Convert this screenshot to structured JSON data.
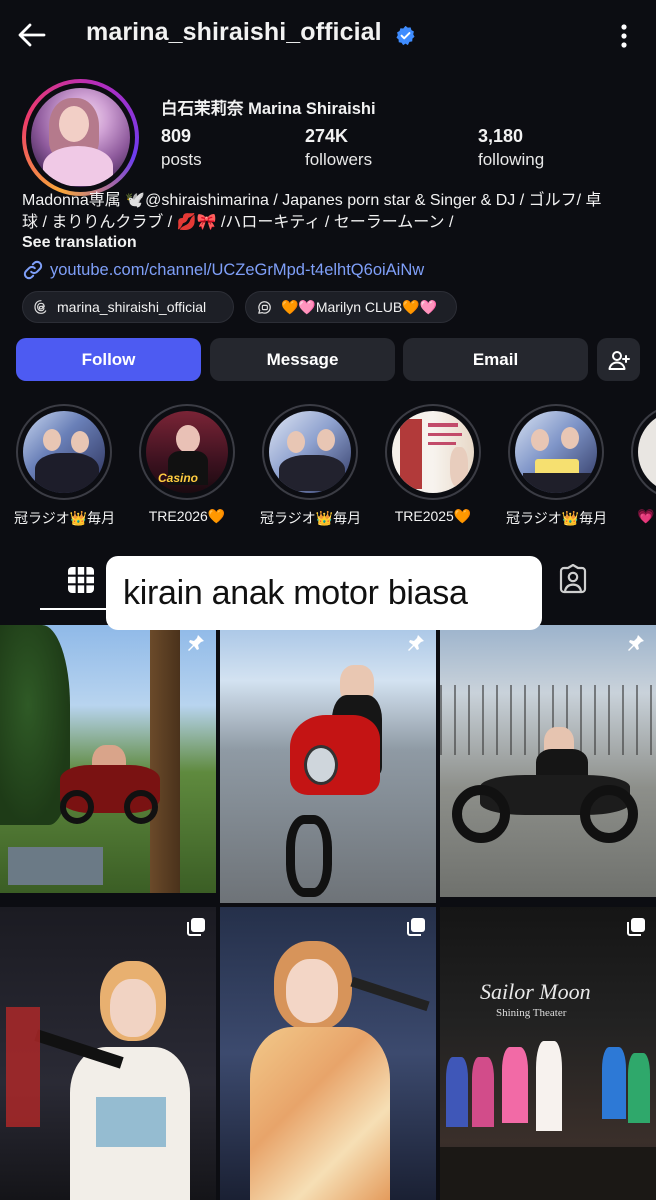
{
  "header": {
    "username": "marina_shiraishi_official",
    "verified": true,
    "icons": {
      "back": "arrow-left-icon",
      "menu": "more-vertical-icon",
      "badge": "verified-badge-icon"
    }
  },
  "profile": {
    "full_name": "白石茉莉奈 Marina Shiraishi",
    "stats": {
      "posts": {
        "value": "809",
        "label": "posts"
      },
      "followers": {
        "value": "274K",
        "label": "followers"
      },
      "following": {
        "value": "3,180",
        "label": "following"
      }
    },
    "bio_line1": "Madonna専属 🕊️@shiraishimarina / Japanes porn star & Singer & DJ / ゴルフ/ 卓",
    "bio_line2": "球 / まりりんクラブ / 💋🎀 /ハローキティ / セーラームーン /",
    "see_translation": "See translation",
    "link": "youtube.com/channel/UCZeGrMpd-t4elhtQ6oiAiNw",
    "chips": [
      {
        "label": "marina_shiraishi_official",
        "icon": "threads-icon"
      },
      {
        "label": "🧡🩷Marilyn CLUB🧡🩷",
        "icon": "broadcast-channel-icon"
      }
    ]
  },
  "actions": {
    "follow": "Follow",
    "message": "Message",
    "email": "Email",
    "add_user_icon": "person-add-icon"
  },
  "highlights": [
    {
      "label": "冠ラジオ👑毎月..."
    },
    {
      "label": "TRE2026🧡"
    },
    {
      "label": "冠ラジオ👑毎月..."
    },
    {
      "label": "TRE2025🧡"
    },
    {
      "label": "冠ラジオ👑毎月..."
    },
    {
      "label": "💗"
    }
  ],
  "tabs": {
    "grid_icon": "grid-icon",
    "tagged_icon": "tagged-user-icon"
  },
  "sticker_text": "kirain anak motor biasa",
  "posts": [
    {
      "description": "motorcycle garden",
      "badge": "pin-icon"
    },
    {
      "description": "red motorcycle",
      "badge": "pin-icon"
    },
    {
      "description": "black motorcycle",
      "badge": "pin-icon"
    },
    {
      "description": "concert microphone",
      "badge": "multiple-photos-icon"
    },
    {
      "description": "kimono singing",
      "badge": "multiple-photos-icon"
    },
    {
      "description": "sailor moon stage",
      "badge": "multiple-photos-icon"
    }
  ],
  "colors": {
    "background": "#0c0d12",
    "primary_button": "#4d5bf2",
    "secondary_button": "#25272e",
    "link": "#7f9ff8",
    "verified": "#3f8cff"
  }
}
